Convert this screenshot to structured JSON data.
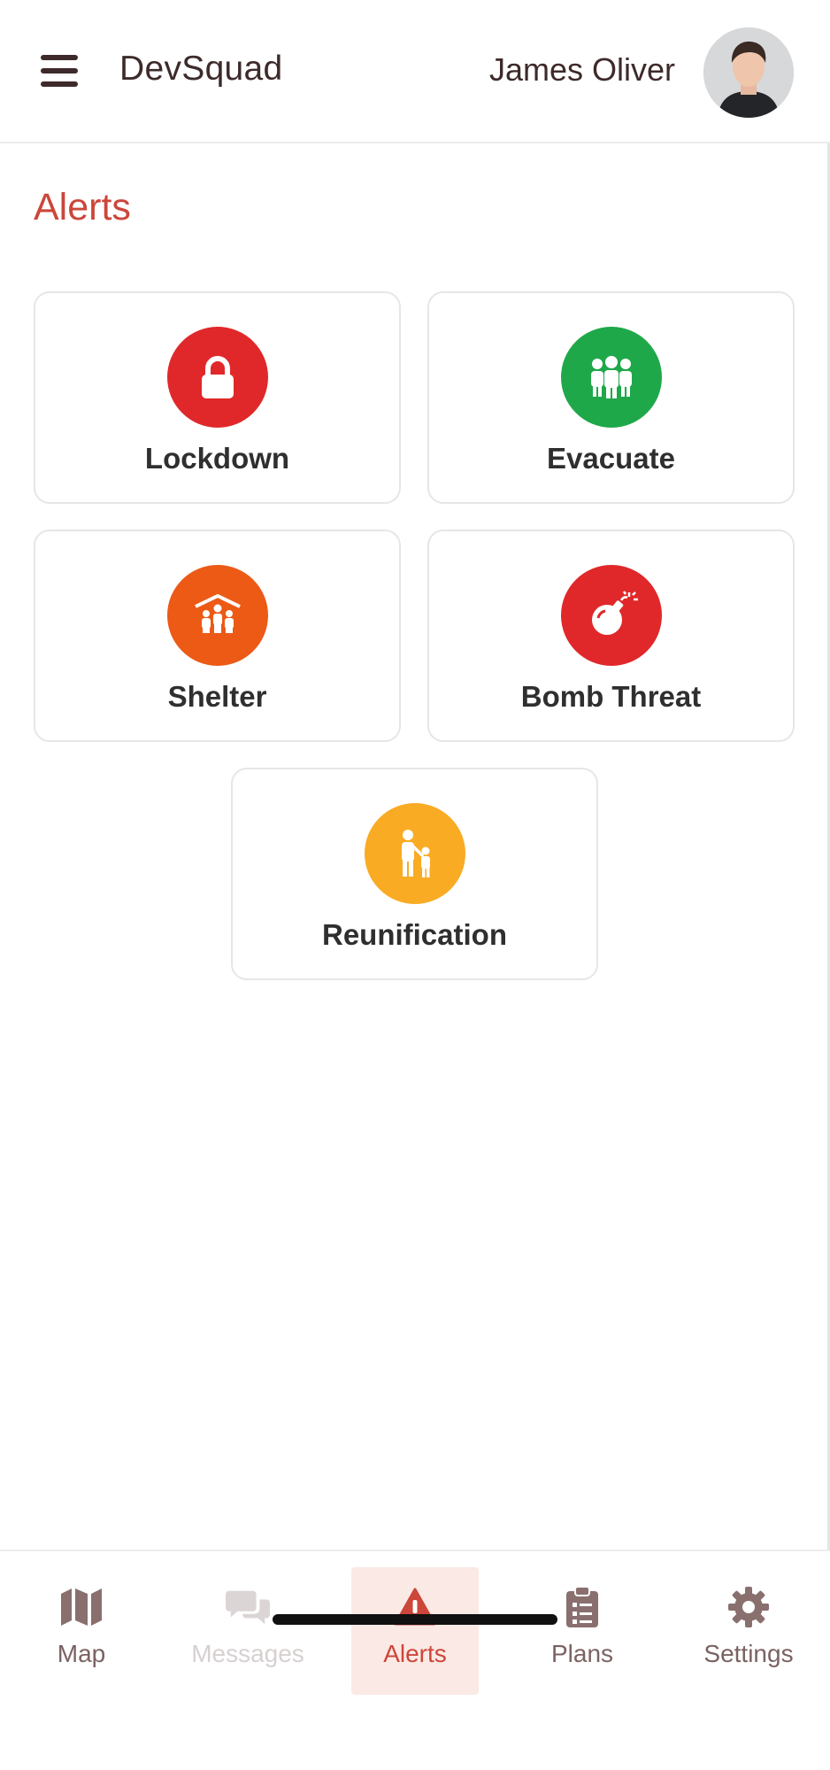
{
  "header": {
    "app_name": "DevSquad",
    "user_name": "James Oliver",
    "menu_icon": "hamburger-menu-icon",
    "avatar_icon": "user-avatar"
  },
  "page": {
    "title": "Alerts"
  },
  "alerts": [
    {
      "label": "Lockdown",
      "icon": "lock-icon",
      "color": "#e0282a"
    },
    {
      "label": "Evacuate",
      "icon": "group-people-icon",
      "color": "#1fa84a"
    },
    {
      "label": "Shelter",
      "icon": "shelter-people-icon",
      "color": "#ec5a16"
    },
    {
      "label": "Bomb Threat",
      "icon": "bomb-icon",
      "color": "#e0282a"
    },
    {
      "label": "Reunification",
      "icon": "parent-child-icon",
      "color": "#f9ab23"
    }
  ],
  "bottom_nav": {
    "active": "Alerts",
    "items": [
      {
        "label": "Map",
        "icon": "map-icon"
      },
      {
        "label": "Messages",
        "icon": "chat-bubbles-icon"
      },
      {
        "label": "Alerts",
        "icon": "warning-triangle-icon"
      },
      {
        "label": "Plans",
        "icon": "clipboard-icon"
      },
      {
        "label": "Settings",
        "icon": "gear-icon"
      }
    ]
  },
  "colors": {
    "accent": "#cc463a",
    "active_tab_bg": "#fbe9e5",
    "nav_text": "#7b6262",
    "disabled_text": "#d8d0d0"
  }
}
